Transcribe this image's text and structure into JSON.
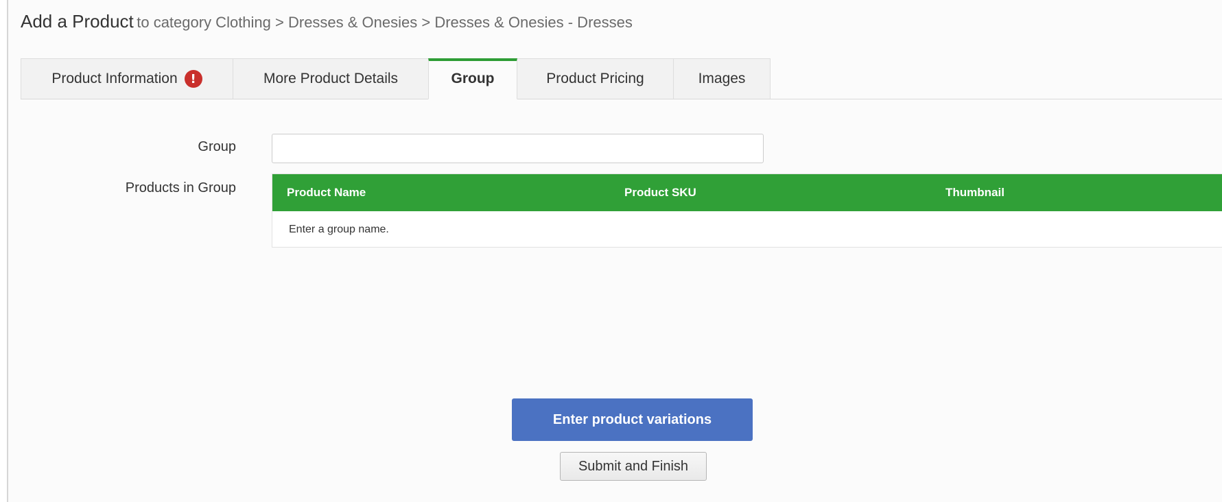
{
  "header": {
    "title": "Add a Product",
    "category_path": "to category Clothing > Dresses & Onesies > Dresses & Onesies - Dresses"
  },
  "tabs": [
    {
      "label": "Product Information",
      "has_error": true,
      "icon": "exclamation-alert-icon"
    },
    {
      "label": "More Product Details"
    },
    {
      "label": "Group",
      "active": true
    },
    {
      "label": "Product Pricing"
    },
    {
      "label": "Images"
    }
  ],
  "form": {
    "group_label": "Group",
    "group_value": "",
    "products_label": "Products in Group"
  },
  "grid": {
    "columns": [
      "Product Name",
      "Product SKU",
      "Thumbnail"
    ],
    "empty_message": "Enter a group name."
  },
  "buttons": {
    "primary": "Enter product variations",
    "secondary": "Submit and Finish"
  },
  "colors": {
    "accent_green": "#30a037",
    "primary_blue": "#4b72c2",
    "error_red": "#c9302c"
  }
}
